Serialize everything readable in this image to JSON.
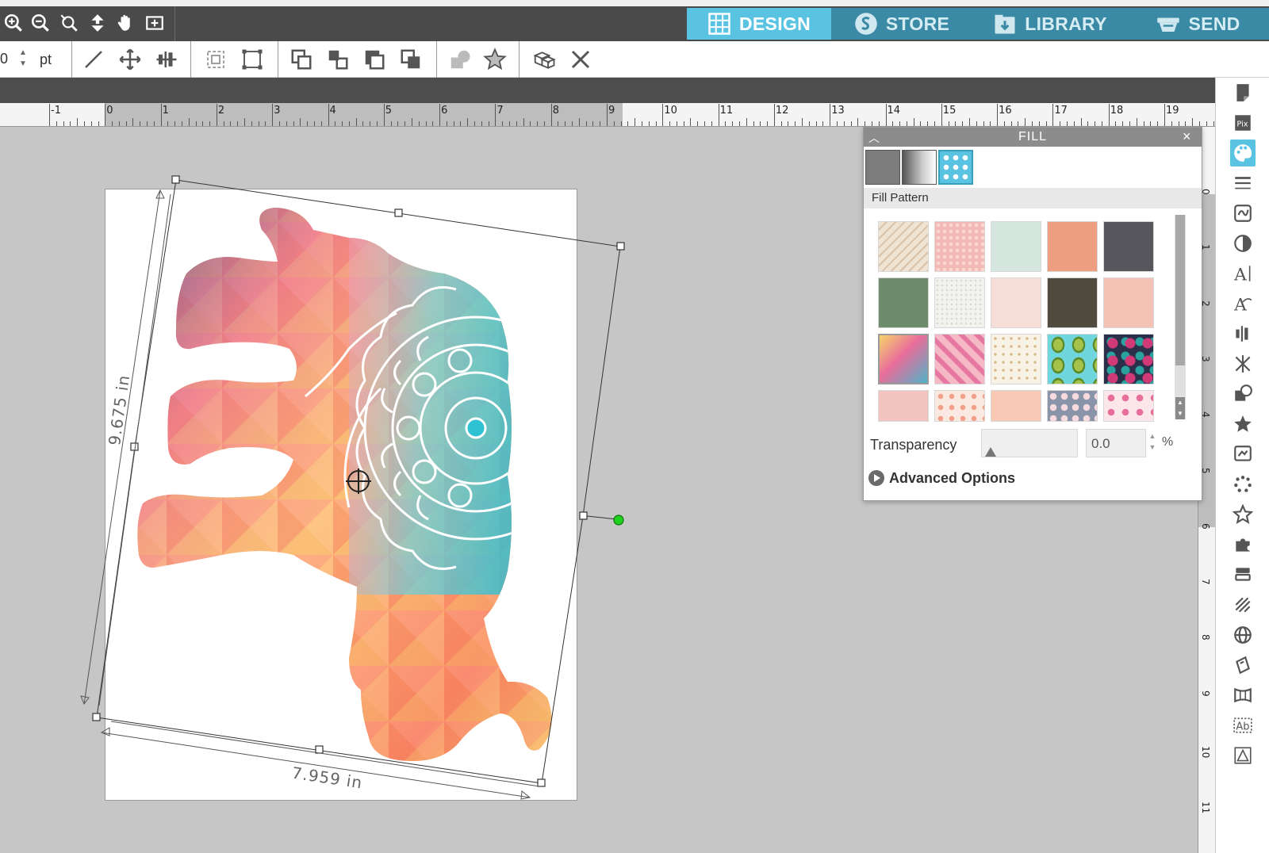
{
  "nav": {
    "design": "DESIGN",
    "store": "STORE",
    "library": "LIBRARY",
    "send": "SEND"
  },
  "toolbar": {
    "unit_value": "0",
    "unit_label": "pt"
  },
  "ruler": {
    "horizontal_labels": [
      "-1",
      "0",
      "1",
      "2",
      "3",
      "4",
      "5",
      "6",
      "7",
      "8",
      "9",
      "10",
      "11",
      "12",
      "13",
      "14",
      "15",
      "16",
      "17",
      "18",
      "19"
    ],
    "vertical_labels": [
      "0",
      "1",
      "2",
      "3",
      "4",
      "5",
      "6",
      "7",
      "8",
      "9",
      "10",
      "11"
    ]
  },
  "canvas": {
    "height_dimension": "9.675 in",
    "width_dimension": "7.959 in"
  },
  "fill_panel": {
    "title": "FILL",
    "section_label": "Fill Pattern",
    "transparency_label": "Transparency",
    "transparency_value": "0.0",
    "transparency_unit": "%",
    "advanced_options": "Advanced Options",
    "swatch_colors": [
      "#efe3d3",
      "#f4b9b4",
      "#d5e6df",
      "#ee9e80",
      "#56565c",
      "#6c8c6c",
      "#f2f2ee",
      "#f6ddd8",
      "#514b3f",
      "#f4c3b6",
      "#e48a6a",
      "#ef9cb0",
      "#f8f2e6",
      "#6fd6de",
      "#2b2f4a",
      "#f2c4c0",
      "#fae9e0",
      "#f7c8b4",
      "#8a94a8",
      "#fbe7ea"
    ]
  }
}
